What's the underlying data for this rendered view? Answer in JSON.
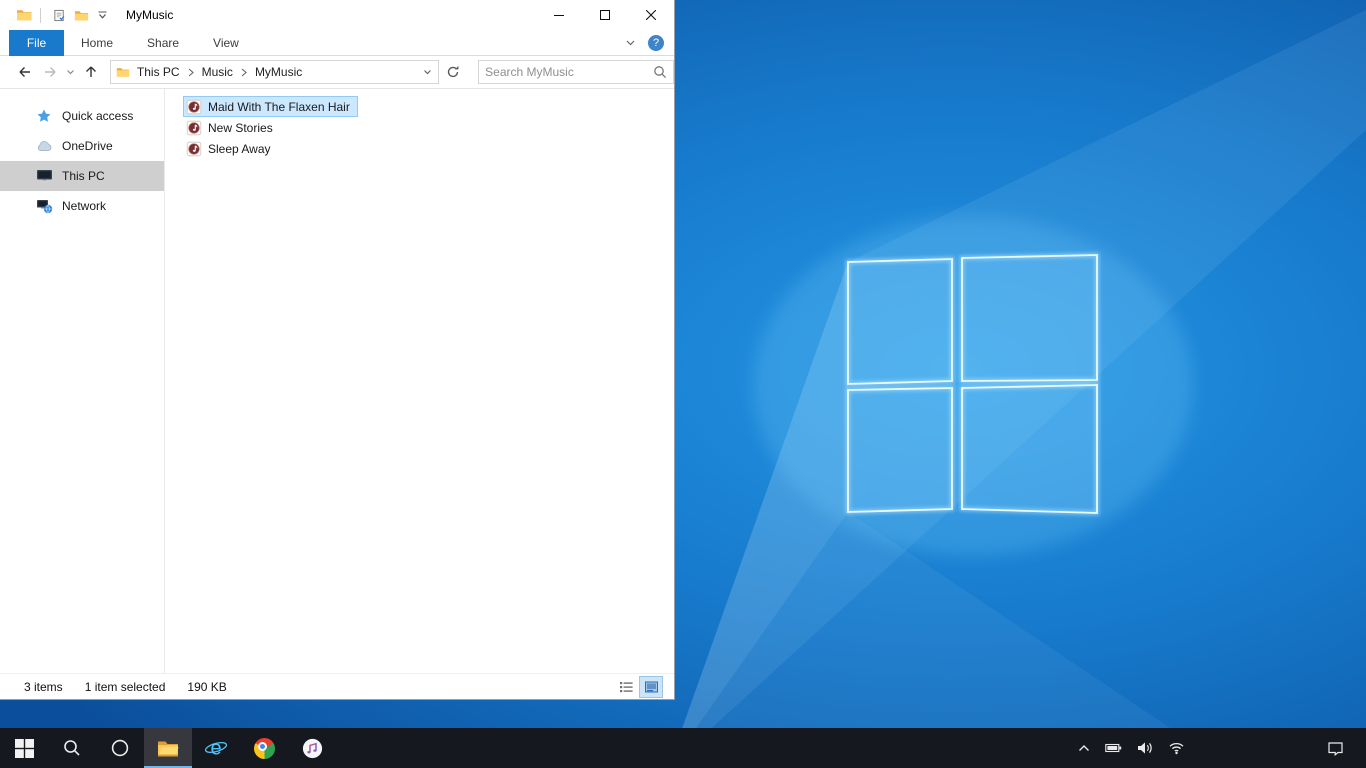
{
  "desktop": {
    "wallpaper": "Windows 10 blue hero with glowing window logo"
  },
  "explorer": {
    "title": "MyMusic",
    "quick_access_toolbar": [
      "properties-icon",
      "new-folder-icon",
      "customize-chevron-icon"
    ],
    "tabs": [
      "File",
      "Home",
      "Share",
      "View"
    ],
    "active_tab": "File",
    "help_glyph": "?",
    "address": {
      "breadcrumb": [
        "This PC",
        "Music",
        "MyMusic"
      ],
      "search_placeholder": "Search MyMusic"
    },
    "sidebar": [
      {
        "label": "Quick access",
        "icon": "star-icon",
        "selected": false
      },
      {
        "label": "OneDrive",
        "icon": "cloud-icon",
        "selected": false
      },
      {
        "label": "This PC",
        "icon": "computer-icon",
        "selected": true
      },
      {
        "label": "Network",
        "icon": "network-icon",
        "selected": false
      }
    ],
    "files": [
      {
        "name": "Maid With The Flaxen Hair",
        "icon": "audio-file-icon",
        "selected": true
      },
      {
        "name": "New Stories",
        "icon": "audio-file-icon",
        "selected": false
      },
      {
        "name": "Sleep Away",
        "icon": "audio-file-icon",
        "selected": false
      }
    ],
    "statusbar": {
      "items": "3 items",
      "selection": "1 item selected",
      "size": "190 KB"
    }
  },
  "taskbar": {
    "buttons": [
      "start",
      "search",
      "cortana",
      "file-explorer",
      "internet-explorer",
      "chrome",
      "itunes"
    ],
    "active_app": "file-explorer",
    "tray": [
      "show-hidden-icons",
      "battery",
      "volume",
      "wifi",
      "action-center"
    ]
  },
  "colors": {
    "accent": "#1979ca",
    "file_selection_bg": "#cce8ff",
    "file_selection_border": "#91c9f7",
    "sidebar_selection_bg": "#cfcfcf",
    "taskbar_bg": "#15181e"
  }
}
